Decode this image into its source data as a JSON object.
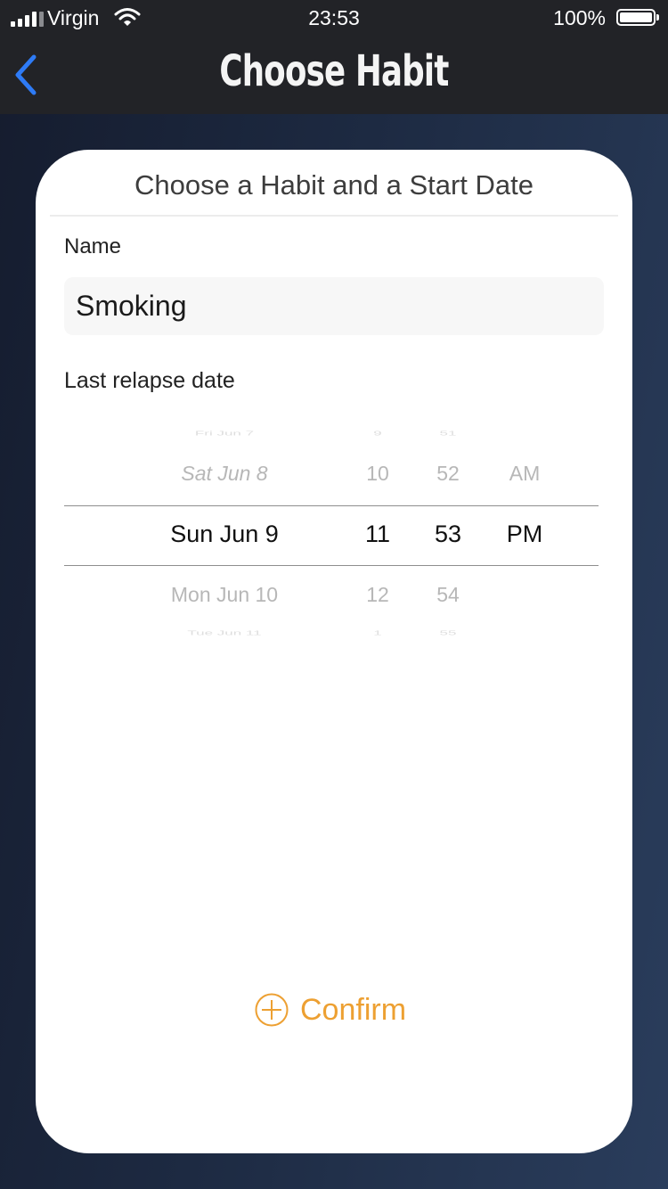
{
  "status_bar": {
    "carrier": "Virgin",
    "time": "23:53",
    "battery_percent": "100%"
  },
  "nav": {
    "title": "Choose Habit"
  },
  "card": {
    "title": "Choose a Habit and a Start Date",
    "name_label": "Name",
    "name_value": "Smoking",
    "relapse_label": "Last relapse date"
  },
  "picker": {
    "dates": [
      "Fri Jun 7",
      "Sat Jun 8",
      "Sun Jun 9",
      "Mon Jun 10",
      "Tue Jun 11"
    ],
    "hours": [
      "9",
      "10",
      "11",
      "12",
      "1"
    ],
    "minutes": [
      "51",
      "52",
      "53",
      "54",
      "55"
    ],
    "periods": [
      "AM",
      "PM"
    ],
    "selected": {
      "date": "Sun Jun 9",
      "hour": "11",
      "minute": "53",
      "period": "PM"
    }
  },
  "confirm_label": "Confirm",
  "colors": {
    "accent": "#eda032",
    "back_arrow": "#2e7bf6",
    "nav_bar": "#222327"
  },
  "icons": {
    "back": "chevron-left-icon",
    "confirm": "plus-circle-icon",
    "wifi": "wifi-icon",
    "signal": "signal-icon",
    "battery": "battery-icon"
  }
}
